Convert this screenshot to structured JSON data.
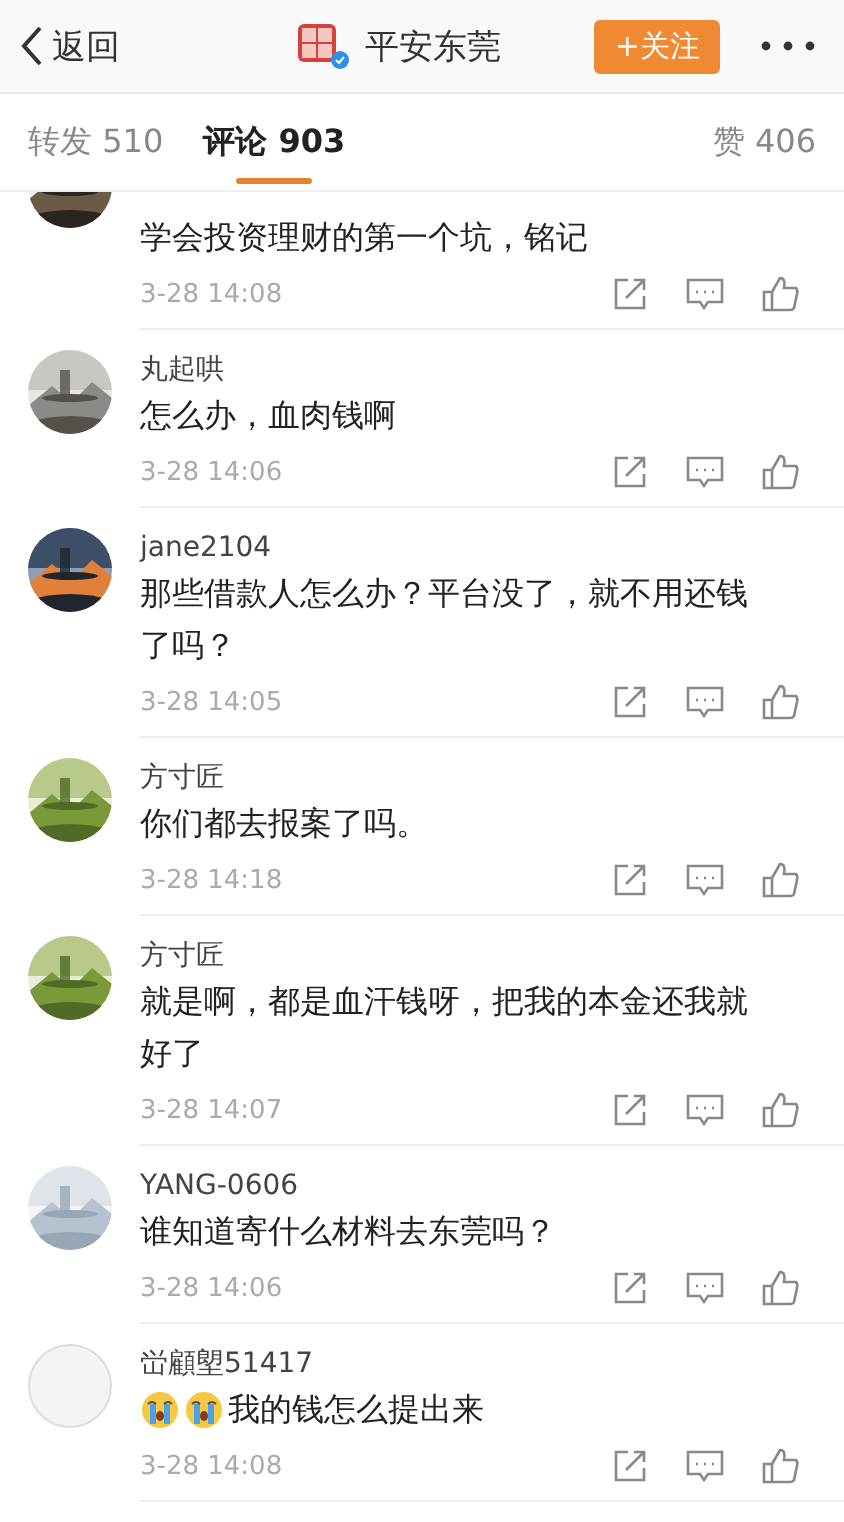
{
  "header": {
    "back": "返回",
    "title": "平安东莞",
    "verified": true,
    "follow": "+关注"
  },
  "tabs": [
    {
      "label": "转发 510",
      "selected": false
    },
    {
      "label": "评论 903",
      "selected": true
    },
    {
      "label": "赞 406",
      "selected": false
    }
  ],
  "comments": [
    {
      "content": [
        {
          "kind": "text",
          "text": "学会投资理财的第一个坑，铭记"
        }
      ],
      "time": "3-28 14:08"
    },
    {
      "name": "丸起哄",
      "content": [
        {
          "kind": "text",
          "text": "怎么办，血肉钱啊"
        }
      ],
      "time": "3-28 14:06"
    },
    {
      "name": "jane2104",
      "content": [
        {
          "kind": "text",
          "text": "那些借款人怎么办？平台没了，就不用还钱了吗？"
        }
      ],
      "time": "3-28 14:05"
    },
    {
      "name": "方寸匠",
      "content": [
        {
          "kind": "text",
          "text": "你们都去报案了吗。"
        }
      ],
      "time": "3-28 14:18"
    },
    {
      "name": "方寸匠",
      "content": [
        {
          "kind": "text",
          "text": "就是啊，都是血汗钱呀，把我的本金还我就好了"
        }
      ],
      "time": "3-28 14:07"
    },
    {
      "name": "YANG-0606",
      "content": [
        {
          "kind": "text",
          "text": "谁知道寄什么材料去东莞吗？"
        }
      ],
      "time": "3-28 14:06"
    },
    {
      "name": "峃顧塱51417",
      "avatar": {
        "kind": "default"
      },
      "content": [
        {
          "kind": "emoji"
        },
        {
          "kind": "emoji"
        },
        {
          "kind": "text",
          "text": "我的钱怎么提出来"
        }
      ],
      "time": "3-28 14:08"
    }
  ]
}
